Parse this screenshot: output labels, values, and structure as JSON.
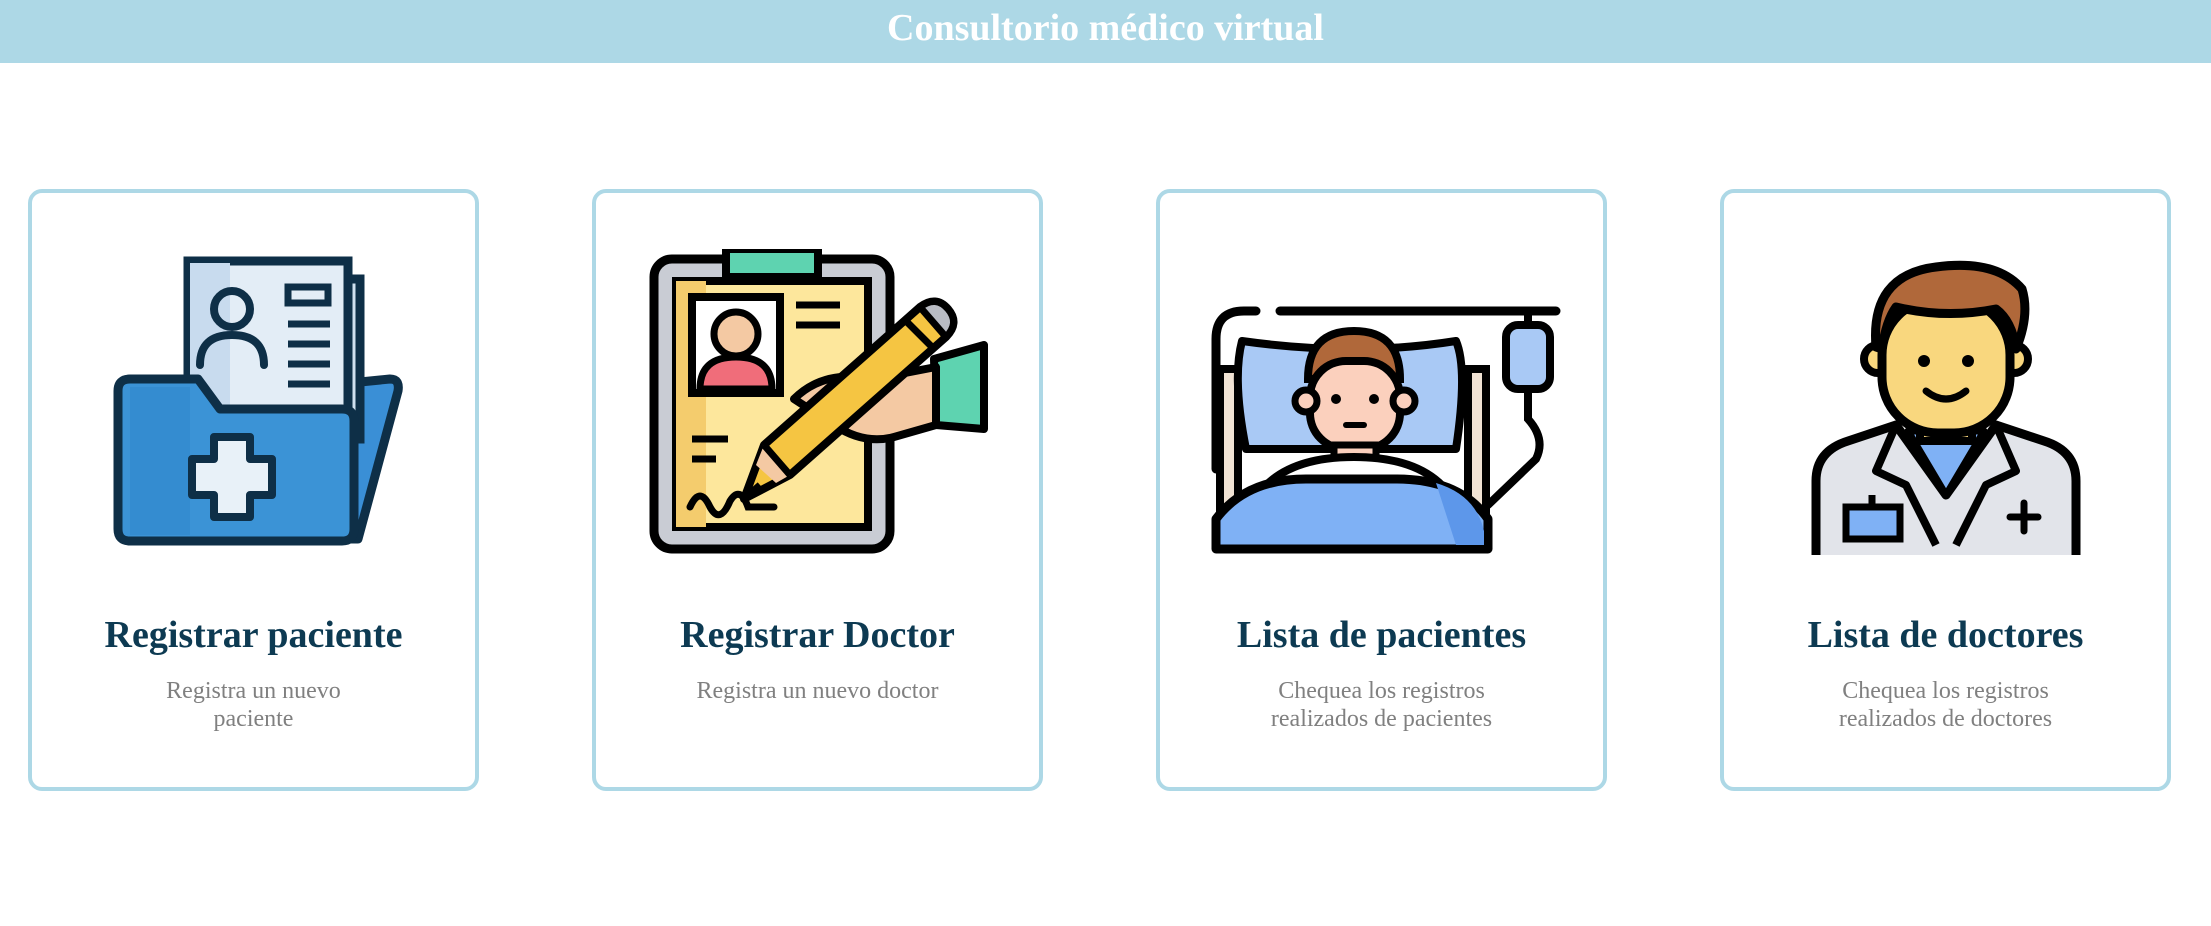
{
  "header": {
    "title": "Consultorio médico virtual"
  },
  "colors": {
    "header_bg": "#add8e6",
    "card_border": "#add8e6",
    "card_title": "#0d3a52",
    "card_desc": "#808080"
  },
  "cards": [
    {
      "title": "Registrar paciente",
      "description": "Registra un nuevo paciente",
      "icon": "patient-folder-icon"
    },
    {
      "title": "Registrar Doctor",
      "description": "Registra un nuevo doctor",
      "icon": "clipboard-register-icon"
    },
    {
      "title": "Lista de pacientes",
      "description": "Chequea los registros realizados de pacientes",
      "icon": "patient-in-bed-icon"
    },
    {
      "title": "Lista de doctores",
      "description": "Chequea los registros realizados de doctores",
      "icon": "doctor-icon"
    }
  ]
}
